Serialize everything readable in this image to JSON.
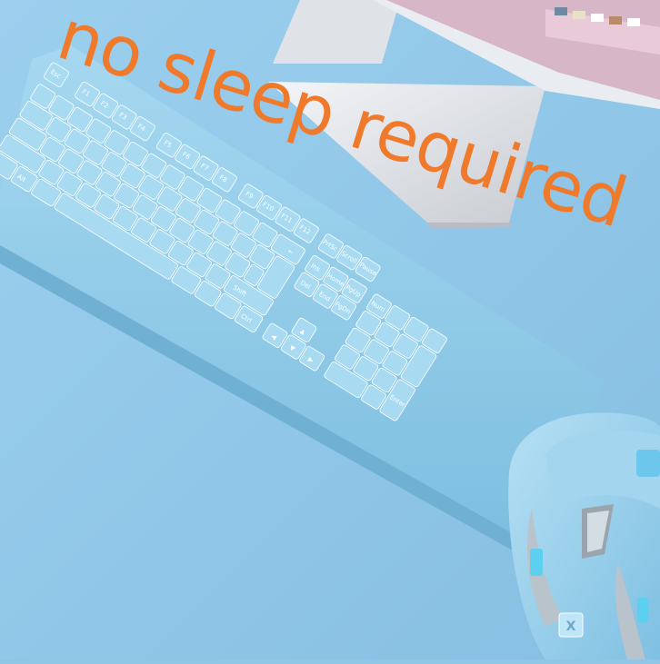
{
  "caption": "no sleep required",
  "colors": {
    "background": "#8fc6e6",
    "keyboard": "#8ccbe8",
    "keycap": "#9fd6f0",
    "caption": "#f07a2c"
  },
  "keyboard": {
    "keys": {
      "esc": "Esc",
      "f1": "F1",
      "f2": "F2",
      "f3": "F3",
      "f4": "F4",
      "f5": "F5",
      "f6": "F6",
      "f7": "F7",
      "f8": "F8",
      "f9": "F9",
      "f10": "F10",
      "f11": "F11",
      "f12": "F12",
      "print": "PrtSc",
      "scroll": "Scroll",
      "pause": "Pause",
      "backspace": "←",
      "ins": "Ins",
      "home": "Home",
      "pgup": "PgUp",
      "del": "Del",
      "end": "End",
      "pgdn": "PgDn",
      "num": "Num",
      "shift": "Shift",
      "ctrl": "Ctrl",
      "alt": "Alt",
      "enter": "Enter"
    }
  },
  "mouse": {
    "logo": "X"
  }
}
